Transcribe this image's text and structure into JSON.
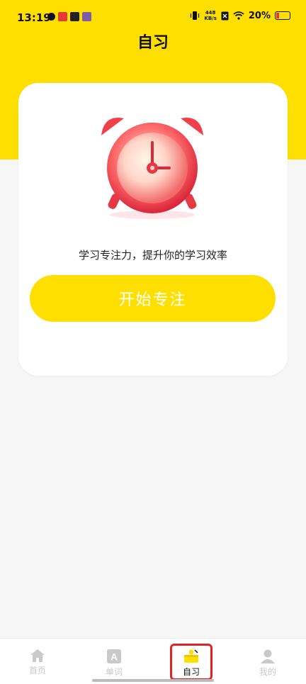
{
  "status_bar": {
    "time": "13:19",
    "net_speed_value": "448",
    "net_speed_unit": "KB/s",
    "battery_percent": "20%",
    "battery_level": 0.2
  },
  "header": {
    "title": "自习"
  },
  "card": {
    "subtitle": "学习专注力，提升你的学习效率",
    "start_button": "开始专注"
  },
  "tabbar": {
    "tabs": [
      {
        "label": "首页",
        "icon": "home-icon",
        "active": false
      },
      {
        "label": "单词",
        "icon": "word-a-icon",
        "active": false
      },
      {
        "label": "自习",
        "icon": "study-desk-icon",
        "active": true
      },
      {
        "label": "我的",
        "icon": "profile-icon",
        "active": false
      }
    ]
  },
  "colors": {
    "brand_yellow": "#FFDF00",
    "clock_red": "#F0404A",
    "highlight_red": "#E02424",
    "inactive_tab": "#C9C9C9"
  }
}
